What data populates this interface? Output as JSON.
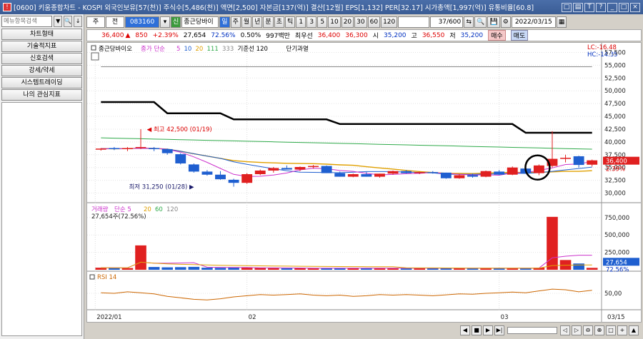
{
  "window": {
    "title": "[0600] 키움종합차트 - KOSPI 외국인보유[57(천)] 주식수[5,486(천)] 액면[2,500] 자본금[137(억)] 결산[12월] EPS[1,132] PER[32.17] 시가총액[1,997(억)] 유통비율[60.8]",
    "app_icon": "kiwoom-logo-icon",
    "buttons": [
      "□",
      "▤",
      "T",
      "?",
      "_",
      "□",
      "×"
    ]
  },
  "left_panel": {
    "search_placeholder": "메뉴항목검색",
    "search_buttons": [
      "▼",
      "🔍",
      "↓"
    ],
    "menu_items": [
      "차트형태",
      "기술적지표",
      "신호검색",
      "강세/약세",
      "시스템트레이딩",
      "나의 관심지표"
    ]
  },
  "toolbar": {
    "mode": "주",
    "type": "전",
    "stock_code": "083160",
    "stock_name": "종근당바이",
    "periods": [
      "일",
      "주",
      "월",
      "년",
      "분",
      "초",
      "틱",
      "1",
      "3",
      "5",
      "10",
      "20",
      "30",
      "60",
      "120"
    ],
    "active_period": "일",
    "count": "37/600",
    "date": "2022/03/15",
    "tools": [
      "⇆",
      "🔍",
      "💾",
      "⚙"
    ]
  },
  "quote": {
    "price": "36,400",
    "arrow": "▲",
    "change": "850",
    "change_pct": "+2.39%",
    "volume": "27,654",
    "vol_ratio": "72.56%",
    "turnover": "0.50%",
    "amount": "997백만",
    "best_label": "최우선",
    "ask": "36,400",
    "bid": "36,300",
    "open_label": "시",
    "open": "35,200",
    "high_label": "고",
    "high": "36,550",
    "low_label": "저",
    "low": "35,200",
    "buy_label": "매수",
    "sell_label": "매도"
  },
  "colors": {
    "up": "#e02020",
    "down": "#1f5fd0",
    "ma5": "#cc33cc",
    "ma10": "#1f5fd0",
    "ma20": "#e0a000",
    "ma111": "#2faa4a",
    "ma333": "#888888",
    "base120": "#000000"
  },
  "chart_data": [
    {
      "type": "candlestick",
      "panel": "price",
      "legend": [
        {
          "text": "종근당바이오",
          "color": "#000000"
        },
        {
          "text": "종가 단순",
          "color": "#cc33cc"
        },
        {
          "text": "5",
          "color": "#cc33cc"
        },
        {
          "text": "10",
          "color": "#1f5fd0"
        },
        {
          "text": "20",
          "color": "#e0a000"
        },
        {
          "text": "111",
          "color": "#2faa4a"
        },
        {
          "text": "333",
          "color": "#888888"
        },
        {
          "text": "기준선 120",
          "color": "#000000"
        },
        {
          "text": "단기과열",
          "color": "#000000"
        }
      ],
      "y_ticks": [
        "57,500",
        "55,000",
        "52,500",
        "50,000",
        "47,500",
        "45,000",
        "42,500",
        "40,000",
        "37,500",
        "35,000",
        "32,500",
        "30,000"
      ],
      "ylim": [
        28400,
        59100
      ],
      "lc": "LC:-16.48",
      "hc": "HC:-14.35",
      "current_price": "36,400",
      "current_pct": "2.39%",
      "annotation_high": "최고 42,500 (01/19)",
      "annotation_low": "최저 31,250 (01/28)",
      "candles": [
        [
          38600,
          38800,
          38300,
          38700
        ],
        [
          38800,
          39000,
          38400,
          38600
        ],
        [
          38600,
          39000,
          38200,
          38800
        ],
        [
          38800,
          42500,
          38600,
          39000
        ],
        [
          38800,
          39000,
          38200,
          38600
        ],
        [
          38600,
          38700,
          37500,
          37800
        ],
        [
          37600,
          37800,
          35600,
          35800
        ],
        [
          35600,
          35800,
          34000,
          34200
        ],
        [
          34200,
          34500,
          33400,
          33600
        ],
        [
          33600,
          34300,
          32600,
          32700
        ],
        [
          32600,
          32800,
          31250,
          32000
        ],
        [
          32000,
          33900,
          31800,
          33700
        ],
        [
          33700,
          34600,
          33500,
          34400
        ],
        [
          34400,
          35100,
          34000,
          34900
        ],
        [
          34900,
          35400,
          34600,
          34600
        ],
        [
          34600,
          35200,
          34300,
          35100
        ],
        [
          35100,
          35500,
          34800,
          35300
        ],
        [
          35300,
          35400,
          33900,
          33900
        ],
        [
          33900,
          34200,
          33200,
          33200
        ],
        [
          33200,
          33800,
          33100,
          33700
        ],
        [
          33700,
          34100,
          33200,
          33200
        ],
        [
          33200,
          33800,
          33000,
          33800
        ],
        [
          33800,
          34400,
          33600,
          34300
        ],
        [
          34300,
          34500,
          33800,
          33900
        ],
        [
          33900,
          34200,
          33700,
          34100
        ],
        [
          34100,
          34300,
          33800,
          34000
        ],
        [
          34000,
          34000,
          32800,
          32900
        ],
        [
          32900,
          33700,
          32800,
          33500
        ],
        [
          33500,
          33800,
          33000,
          33200
        ],
        [
          33200,
          34400,
          33100,
          34300
        ],
        [
          34200,
          34500,
          33500,
          33600
        ],
        [
          33600,
          35200,
          33500,
          35000
        ],
        [
          34800,
          35000,
          33800,
          33900
        ],
        [
          33900,
          35600,
          33500,
          35400
        ],
        [
          35300,
          42100,
          35000,
          36700
        ],
        [
          36800,
          37500,
          36000,
          36900
        ],
        [
          37200,
          37300,
          35000,
          35500
        ],
        [
          35550,
          36550,
          35200,
          36400
        ]
      ]
    },
    {
      "type": "bar",
      "panel": "volume",
      "legend": [
        {
          "text": "거래량",
          "color": "#cc33cc"
        },
        {
          "text": "단순 5",
          "color": "#cc33cc"
        },
        {
          "text": "20",
          "color": "#e0a000"
        },
        {
          "text": "60",
          "color": "#2faa4a"
        },
        {
          "text": "120",
          "color": "#888888"
        }
      ],
      "info": "27,654주(72.56%)",
      "y_ticks": [
        "750,000",
        "500,000",
        "250,000"
      ],
      "ylim": [
        0,
        820000
      ],
      "current": "27,654",
      "current_pct": "72.56%",
      "values": [
        30000,
        28000,
        25000,
        350000,
        40000,
        35000,
        38000,
        42000,
        30000,
        28000,
        32000,
        30000,
        26000,
        24000,
        22000,
        25000,
        20000,
        22000,
        26000,
        24000,
        21000,
        23000,
        25000,
        20000,
        22000,
        24000,
        26000,
        21000,
        20000,
        23000,
        25000,
        22000,
        24000,
        30000,
        760000,
        140000,
        90000,
        27654
      ]
    },
    {
      "type": "line",
      "panel": "rsi",
      "legend": [
        {
          "text": "RSI 14",
          "color": "#cc6600"
        }
      ],
      "y_ticks": [
        "50,00"
      ],
      "ylim": [
        0,
        100
      ],
      "values": [
        52,
        50,
        55,
        52,
        48,
        40,
        35,
        30,
        28,
        32,
        38,
        42,
        46,
        44,
        46,
        48,
        44,
        42,
        44,
        40,
        42,
        46,
        44,
        46,
        44,
        42,
        45,
        48,
        47,
        50,
        52,
        54,
        52,
        58,
        64,
        62,
        55,
        60
      ]
    }
  ],
  "x_axis": {
    "labels": [
      "2022/01",
      "02",
      "03",
      "03/15"
    ]
  },
  "bottom_buttons": [
    "◀",
    "■",
    "▶",
    "▶|",
    "◁",
    "▷",
    "⊖",
    "⊕",
    "□",
    "+",
    "▲"
  ]
}
